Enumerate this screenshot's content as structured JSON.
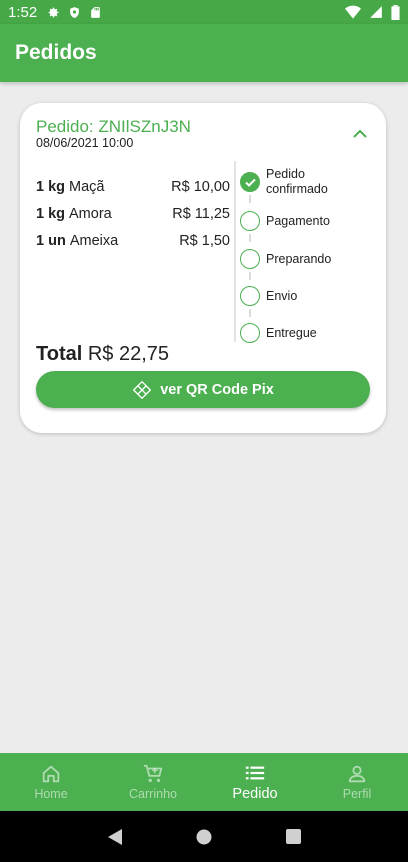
{
  "status_bar": {
    "time": "1:52"
  },
  "app_bar": {
    "title": "Pedidos"
  },
  "order": {
    "id_label": "Pedido: ZNIlSZnJ3N",
    "date": "08/06/2021 10:00",
    "items": [
      {
        "qty": "1 kg",
        "name": "Maçã",
        "price": "R$ 10,00"
      },
      {
        "qty": "1 kg",
        "name": "Amora",
        "price": "R$ 11,25"
      },
      {
        "qty": "1 un",
        "name": "Ameixa",
        "price": "R$ 1,50"
      }
    ],
    "steps": [
      {
        "label_line1": "Pedido",
        "label_line2": "confirmado",
        "done": true
      },
      {
        "label_line1": "Pagamento",
        "label_line2": "",
        "done": false
      },
      {
        "label_line1": "Preparando",
        "label_line2": "",
        "done": false
      },
      {
        "label_line1": "Envio",
        "label_line2": "",
        "done": false
      },
      {
        "label_line1": "Entregue",
        "label_line2": "",
        "done": false
      }
    ],
    "total_label": "Total",
    "total_value": "R$ 22,75",
    "pix_button_label": "ver QR Code Pix"
  },
  "bottom_nav": {
    "items": [
      {
        "label": "Home",
        "icon": "home-icon",
        "active": false
      },
      {
        "label": "Carrinho",
        "icon": "cart-icon",
        "active": false
      },
      {
        "label": "Pedido",
        "icon": "list-icon",
        "active": true
      },
      {
        "label": "Perfil",
        "icon": "person-icon",
        "active": false
      }
    ]
  },
  "colors": {
    "primary": "#4caf50",
    "status_bar": "#46a846",
    "background": "#ececec"
  }
}
